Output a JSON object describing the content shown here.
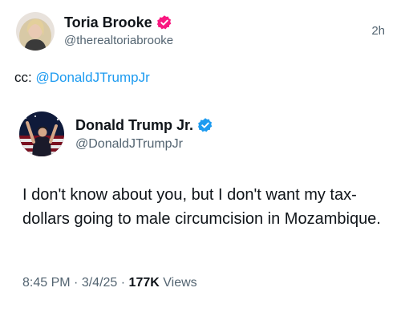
{
  "outer_tweet": {
    "author_name": "Toria Brooke",
    "author_handle": "@therealtoriabrooke",
    "time": "2h",
    "badge_icon": "verified-badge-pink",
    "badge_color": "#f91880",
    "text_prefix": "cc: ",
    "mention": "@DonaldJTrumpJr"
  },
  "quoted_tweet": {
    "author_name": "Donald Trump Jr.",
    "author_handle": "@DonaldJTrumpJr",
    "badge_icon": "verified-badge-blue",
    "badge_color": "#1d9bf0",
    "text": "I don't know about you, but I don't want my tax-dollars going to male circumcision in Mozambique.",
    "time": "8:45 PM",
    "separator": "·",
    "date": "3/4/25",
    "views_count": "177K",
    "views_label": "Views"
  },
  "colors": {
    "text_primary": "#0f1419",
    "text_secondary": "#536471",
    "link": "#1d9bf0"
  }
}
